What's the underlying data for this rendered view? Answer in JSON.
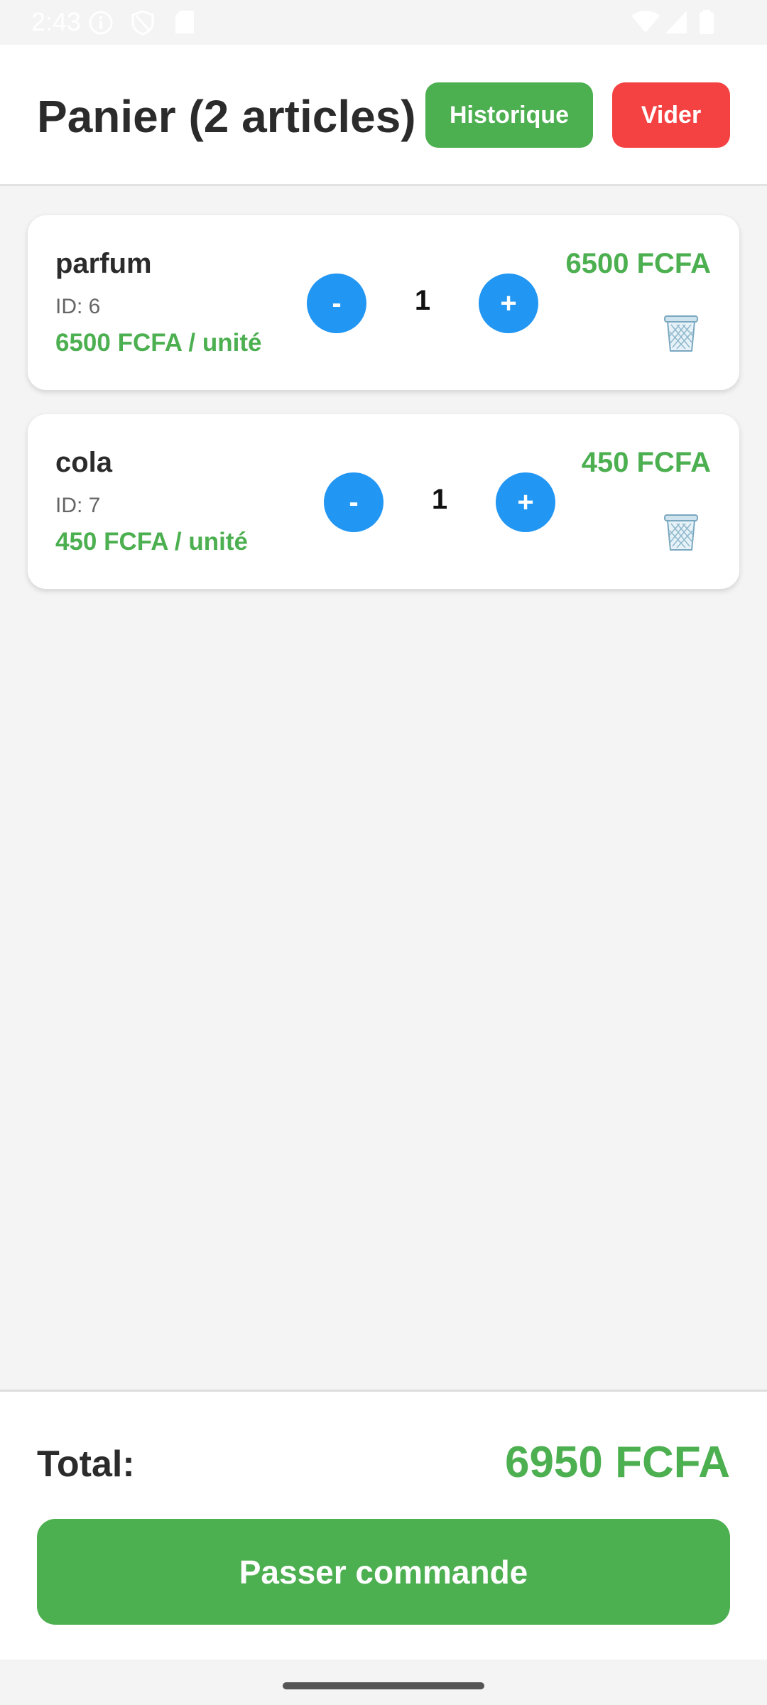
{
  "status_bar": {
    "time": "2:43",
    "left_icons": [
      "info-icon",
      "shield-icon",
      "sd-card-icon"
    ],
    "right_icons": [
      "wifi-icon",
      "cellular-icon",
      "battery-icon"
    ]
  },
  "header": {
    "title": "Panier (2 articles)",
    "history_label": "Historique",
    "clear_label": "Vider",
    "history_color": "#4caf50",
    "clear_color": "#f44242"
  },
  "cart": {
    "items": [
      {
        "name": "parfum",
        "id_text": "ID: 6",
        "unit_price": "6500 FCFA / unité",
        "minus_label": "-",
        "quantity": "1",
        "plus_label": "+",
        "line_total": "6500 FCFA",
        "delete_icon": "trash-icon"
      },
      {
        "name": "cola",
        "id_text": "ID: 7",
        "unit_price": "450 FCFA / unité",
        "minus_label": "-",
        "quantity": "1",
        "plus_label": "+",
        "line_total": "450 FCFA",
        "delete_icon": "trash-icon"
      }
    ]
  },
  "footer": {
    "total_label": "Total:",
    "total_value": "6950 FCFA",
    "checkout_label": "Passer commande"
  },
  "colors": {
    "accent_green": "#4caf50",
    "accent_blue": "#2196f3",
    "danger_red": "#f44242"
  }
}
